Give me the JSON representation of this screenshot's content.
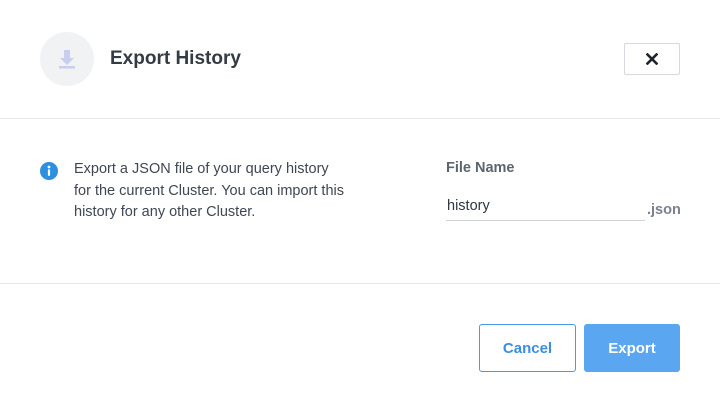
{
  "header": {
    "icon": "download-icon",
    "title": "Export History",
    "close_icon": "close-icon"
  },
  "body": {
    "info_icon": "info-icon",
    "description": "Export a JSON file of your query history for the current Cluster. You can import this history for any other Cluster.",
    "file_name_label": "File Name",
    "file_name_value": "history",
    "extension": ".json"
  },
  "footer": {
    "cancel_label": "Cancel",
    "export_label": "Export"
  },
  "colors": {
    "accent": "#5aa6f0",
    "cancel_text": "#3b8ee2",
    "info_icon": "#2d8fe0"
  }
}
